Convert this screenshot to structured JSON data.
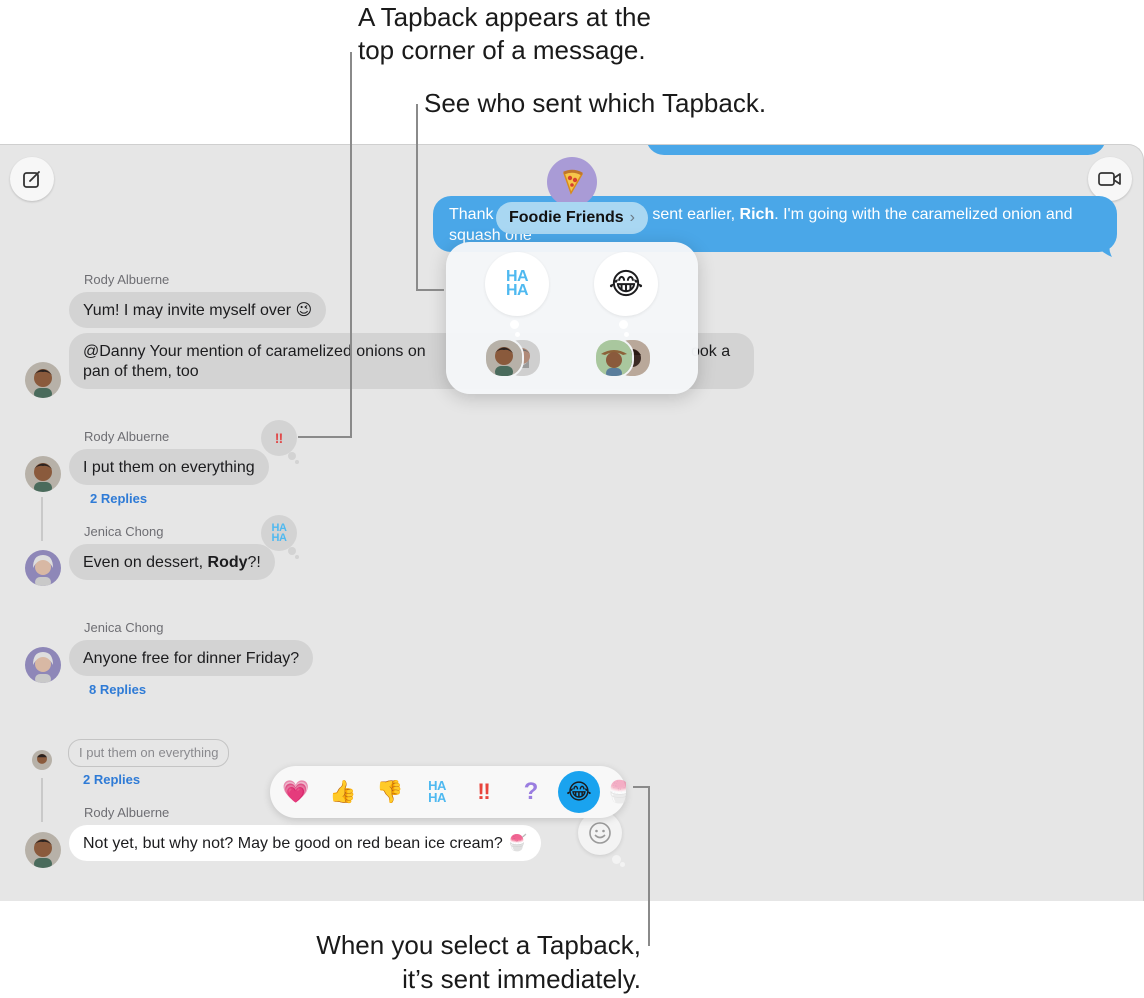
{
  "callouts": {
    "top_line1": "A Tapback appears at the",
    "top_line2": "top corner of a message.",
    "middle": "See who sent which Tapback.",
    "bottom_line1": "When you select a Tapback,",
    "bottom_line2": "it’s sent immediately."
  },
  "toolbar": {
    "compose_icon": "compose-icon",
    "video_icon": "video-camera-icon"
  },
  "outgoing_message": {
    "text_start": "Thank",
    "text_middle": "sent earlier,",
    "text_bold": "Rich",
    "text_end": ". I'm going with the caramelized onion and",
    "text_line2": "squash one",
    "reaction": "pizza"
  },
  "group_pill": {
    "label": "Foodie Friends",
    "chevron": "›"
  },
  "popover": {
    "reactions": [
      {
        "type": "haha",
        "label_top": "HA",
        "label_bottom": "HA"
      },
      {
        "type": "tears-of-joy",
        "glyph": "😂"
      }
    ]
  },
  "messages": [
    {
      "sender": "Rody Albuerne",
      "text": "Yum! I may invite myself over 😉"
    },
    {
      "line1": "@Danny Your mention of caramelized onions on",
      "line1_end": "ook a",
      "line2": "pan of them, too"
    },
    {
      "sender": "Rody Albuerne",
      "text": "I put them on everything",
      "replies": "2 Replies",
      "tapback": "‼"
    },
    {
      "sender": "Jenica Chong",
      "text_start": "Even on dessert, ",
      "text_bold": "Rody",
      "text_end": "?!",
      "tapback_top": "HA",
      "tapback_bottom": "HA"
    },
    {
      "sender": "Jenica Chong",
      "text": "Anyone free for dinner Friday?",
      "replies": "8 Replies"
    },
    {
      "quote": "I put them on everything",
      "replies": "2 Replies"
    },
    {
      "sender": "Rody Albuerne",
      "text": "Not yet, but why not? May be good on red bean ice cream? 🍧"
    }
  ],
  "tapback_bar": {
    "items": [
      "heart",
      "thumbs-up",
      "thumbs-down",
      "haha",
      "exclamation",
      "question",
      "tears-of-joy",
      "shaved-ice"
    ],
    "heart": "💗",
    "thumbs_up": "👍",
    "thumbs_down": "👎",
    "haha_top": "HA",
    "haha_bottom": "HA",
    "exclamation": "‼",
    "question": "?",
    "tears_of_joy": "😂",
    "shaved_ice": "🍧",
    "selected": "tears-of-joy",
    "emoji_picker": "smiley-icon"
  },
  "colors": {
    "outgoing_bubble": "#4aa7e8",
    "incoming_bubble": "#d3d3d3",
    "replies_link": "#2f7bd6",
    "selected_tapback": "#1aa3ef",
    "window_bg": "#e6e6e6"
  }
}
